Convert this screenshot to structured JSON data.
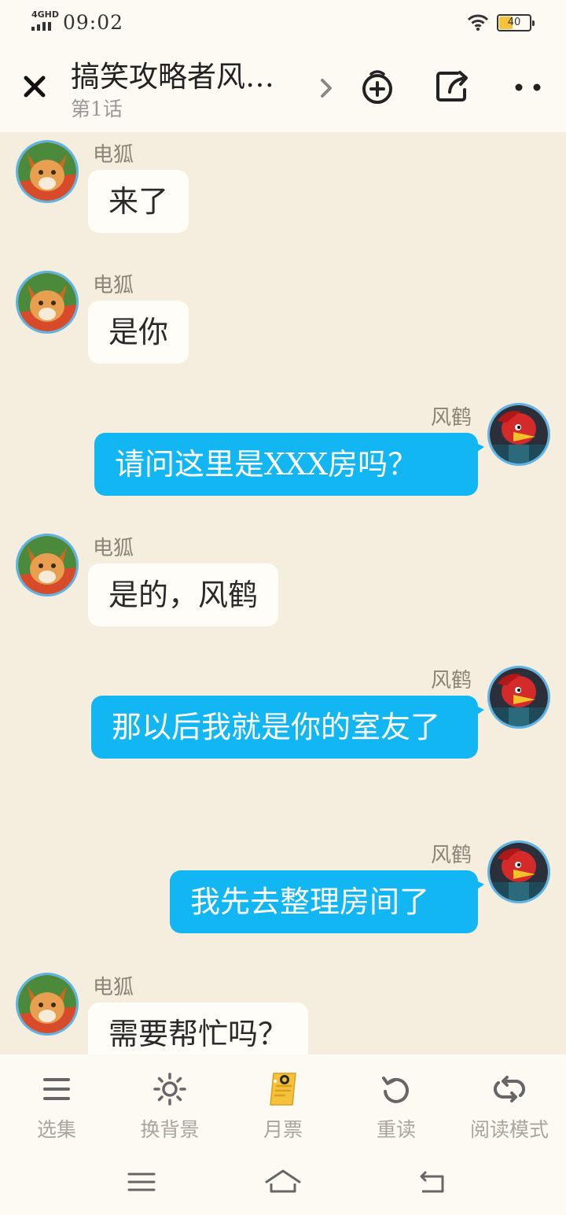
{
  "status_bar": {
    "network": "4GHD",
    "time": "09:02",
    "battery": "40"
  },
  "header": {
    "title": "搞笑攻略者风…",
    "subtitle": "第1话"
  },
  "messages": [
    {
      "sender": "电狐",
      "text": "来了",
      "side": "left",
      "avatar": "fox-avatar"
    },
    {
      "sender": "电狐",
      "text": "是你",
      "side": "left",
      "avatar": "fox-avatar"
    },
    {
      "sender": "风鹤",
      "text": "请问这里是XXX房吗？",
      "side": "right",
      "avatar": "crane-avatar"
    },
    {
      "sender": "电狐",
      "text": "是的，风鹤",
      "side": "left",
      "avatar": "fox-avatar"
    },
    {
      "sender": "风鹤",
      "text": "那以后我就是你的室友了",
      "side": "right",
      "avatar": "crane-avatar"
    },
    {
      "sender": "风鹤",
      "text": "我先去整理房间了",
      "side": "right",
      "avatar": "crane-avatar"
    },
    {
      "sender": "电狐",
      "text": "需要帮忙吗？",
      "side": "left",
      "avatar": "fox-avatar"
    }
  ],
  "toolbar": [
    {
      "label": "选集",
      "icon": "list-icon"
    },
    {
      "label": "换背景",
      "icon": "sun-icon"
    },
    {
      "label": "月票",
      "icon": "ticket-icon"
    },
    {
      "label": "重读",
      "icon": "reread-icon"
    },
    {
      "label": "阅读模式",
      "icon": "reading-mode-icon"
    }
  ],
  "colors": {
    "background": "#f5eedf",
    "bubble_right": "#12b6f2",
    "bubble_left": "#fffdf7",
    "avatar_ring": "#5fb3e4"
  }
}
